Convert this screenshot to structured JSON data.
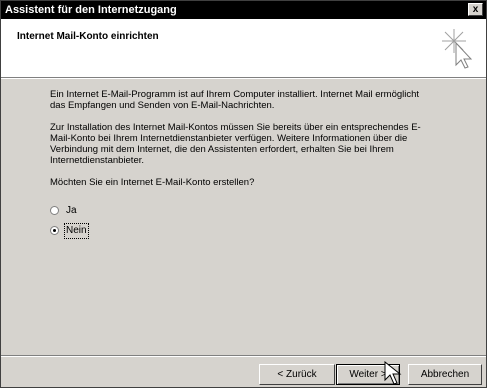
{
  "window": {
    "title": "Assistent für den Internetzugang",
    "close_label": "x"
  },
  "header": {
    "heading": "Internet Mail-Konto einrichten",
    "icon": "wizard-icon"
  },
  "content": {
    "paragraph1": "Ein Internet E-Mail-Programm ist auf Ihrem Computer installiert. Internet Mail ermöglicht das Empfangen und Senden von E-Mail-Nachrichten.",
    "paragraph2": "Zur Installation des Internet Mail-Kontos müssen Sie bereits über ein entsprechendes E-Mail-Konto bei Ihrem Internetdienstanbieter verfügen. Weitere Informationen über die Verbindung mit dem Internet, die den Assistenten erfordert, erhalten Sie bei Ihrem Internetdienstanbieter.",
    "question": "Möchten Sie ein Internet E-Mail-Konto erstellen?"
  },
  "options": [
    {
      "label": "Ja",
      "checked": false
    },
    {
      "label": "Nein",
      "checked": true
    }
  ],
  "buttons": {
    "back": "< Zurück",
    "next": "Weiter >",
    "cancel": "Abbrechen"
  }
}
